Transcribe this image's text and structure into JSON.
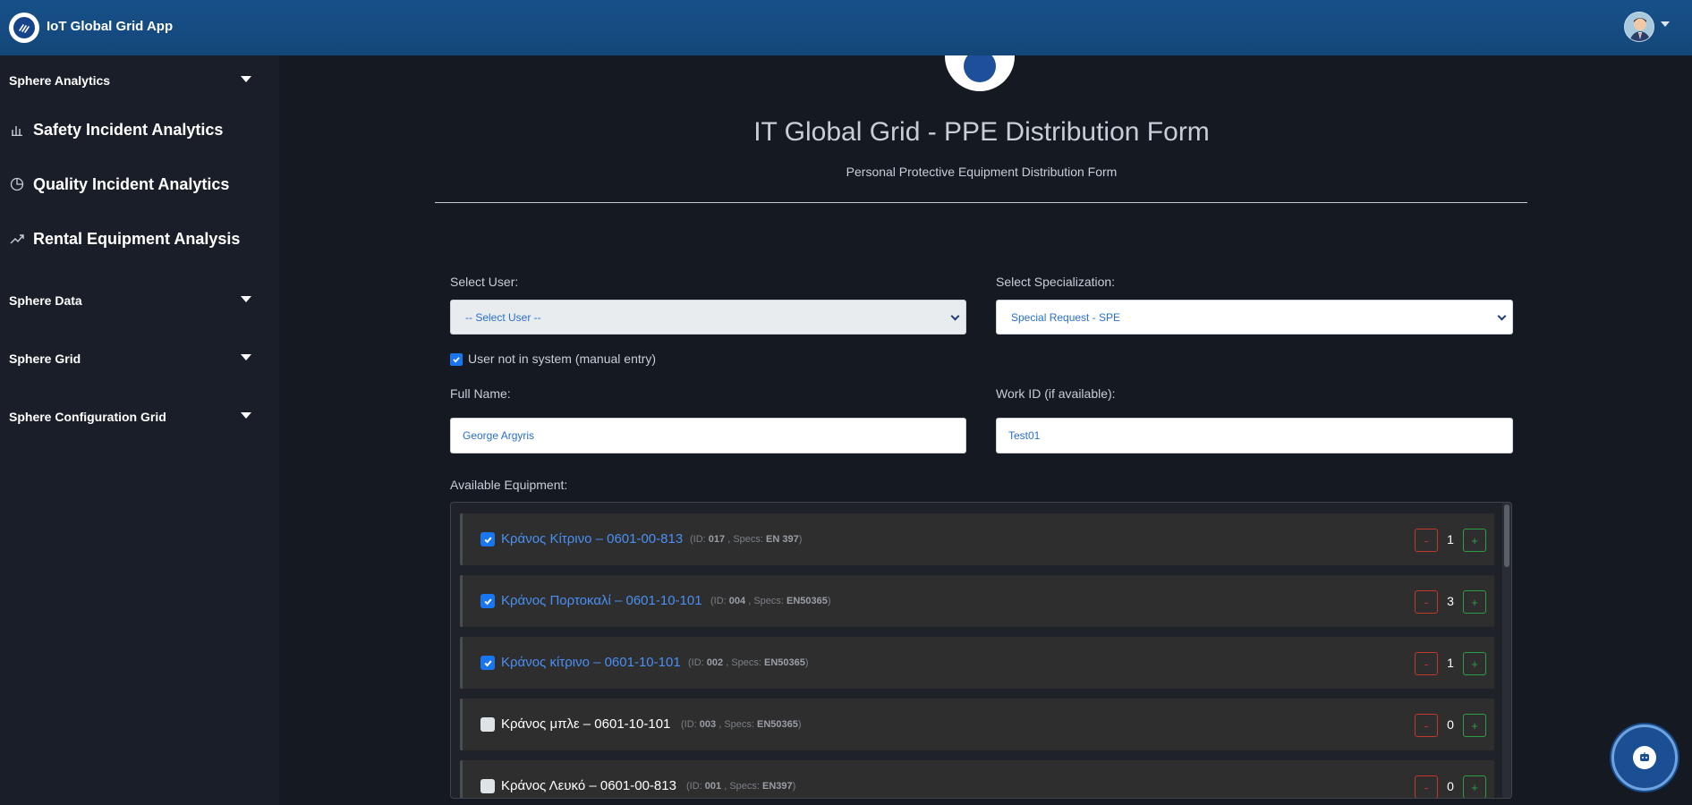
{
  "header": {
    "app_title": "IoT Global Grid App",
    "logo_icon": "grid-logo-icon",
    "avatar_icon": "user-avatar-icon"
  },
  "sidebar": {
    "sections": [
      {
        "label": "Sphere Analytics",
        "expanded": true
      },
      {
        "label": "Sphere Data"
      },
      {
        "label": "Sphere Grid"
      },
      {
        "label": "Sphere Configuration Grid"
      }
    ],
    "items": [
      {
        "label": "Safety Incident Analytics",
        "icon": "bar-chart-icon"
      },
      {
        "label": "Quality Incident Analytics",
        "icon": "pie-chart-icon"
      },
      {
        "label": "Rental Equipment Analysis",
        "icon": "trending-up-icon"
      }
    ]
  },
  "form": {
    "title": "IT Global Grid - PPE Distribution Form",
    "subtitle": "Personal Protective Equipment Distribution Form",
    "select_user_label": "Select User:",
    "select_user_value": "-- Select User --",
    "select_spec_label": "Select Specialization:",
    "select_spec_value": "Special Request - SPE",
    "manual_entry_label": "User not in system (manual entry)",
    "manual_entry_checked": true,
    "full_name_label": "Full Name:",
    "full_name_value": "George Argyris",
    "work_id_label": "Work ID (if available):",
    "work_id_value": "Test01",
    "equipment_label": "Available Equipment:"
  },
  "equipment": [
    {
      "name": "Κράνος Κίτρινο – 0601-00-813",
      "id_label": "(ID:",
      "id": "017",
      "specs_label": ", Specs:",
      "specs": "EN 397",
      "close": ")",
      "qty": "1",
      "checked": true
    },
    {
      "name": "Κράνος Πορτοκαλί – 0601-10-101",
      "id_label": "(ID:",
      "id": "004",
      "specs_label": ", Specs:",
      "specs": "EN50365",
      "close": ")",
      "qty": "3",
      "checked": true
    },
    {
      "name": "Κράνος κίτρινο – 0601-10-101",
      "id_label": "(ID:",
      "id": "002",
      "specs_label": ", Specs:",
      "specs": "EN50365",
      "close": ")",
      "qty": "1",
      "checked": true
    },
    {
      "name": "Κράνος μπλε – 0601-10-101",
      "id_label": "(ID:",
      "id": "003",
      "specs_label": ", Specs:",
      "specs": "EN50365",
      "close": ")",
      "qty": "0",
      "checked": false
    },
    {
      "name": "Κράνος Λευκό – 0601-00-813",
      "id_label": "(ID:",
      "id": "001",
      "specs_label": ", Specs:",
      "specs": "EN397",
      "close": ")",
      "qty": "0",
      "checked": false
    }
  ],
  "controls": {
    "minus_label": "-",
    "plus_label": "+"
  },
  "chat": {
    "icon": "chat-bot-icon"
  }
}
